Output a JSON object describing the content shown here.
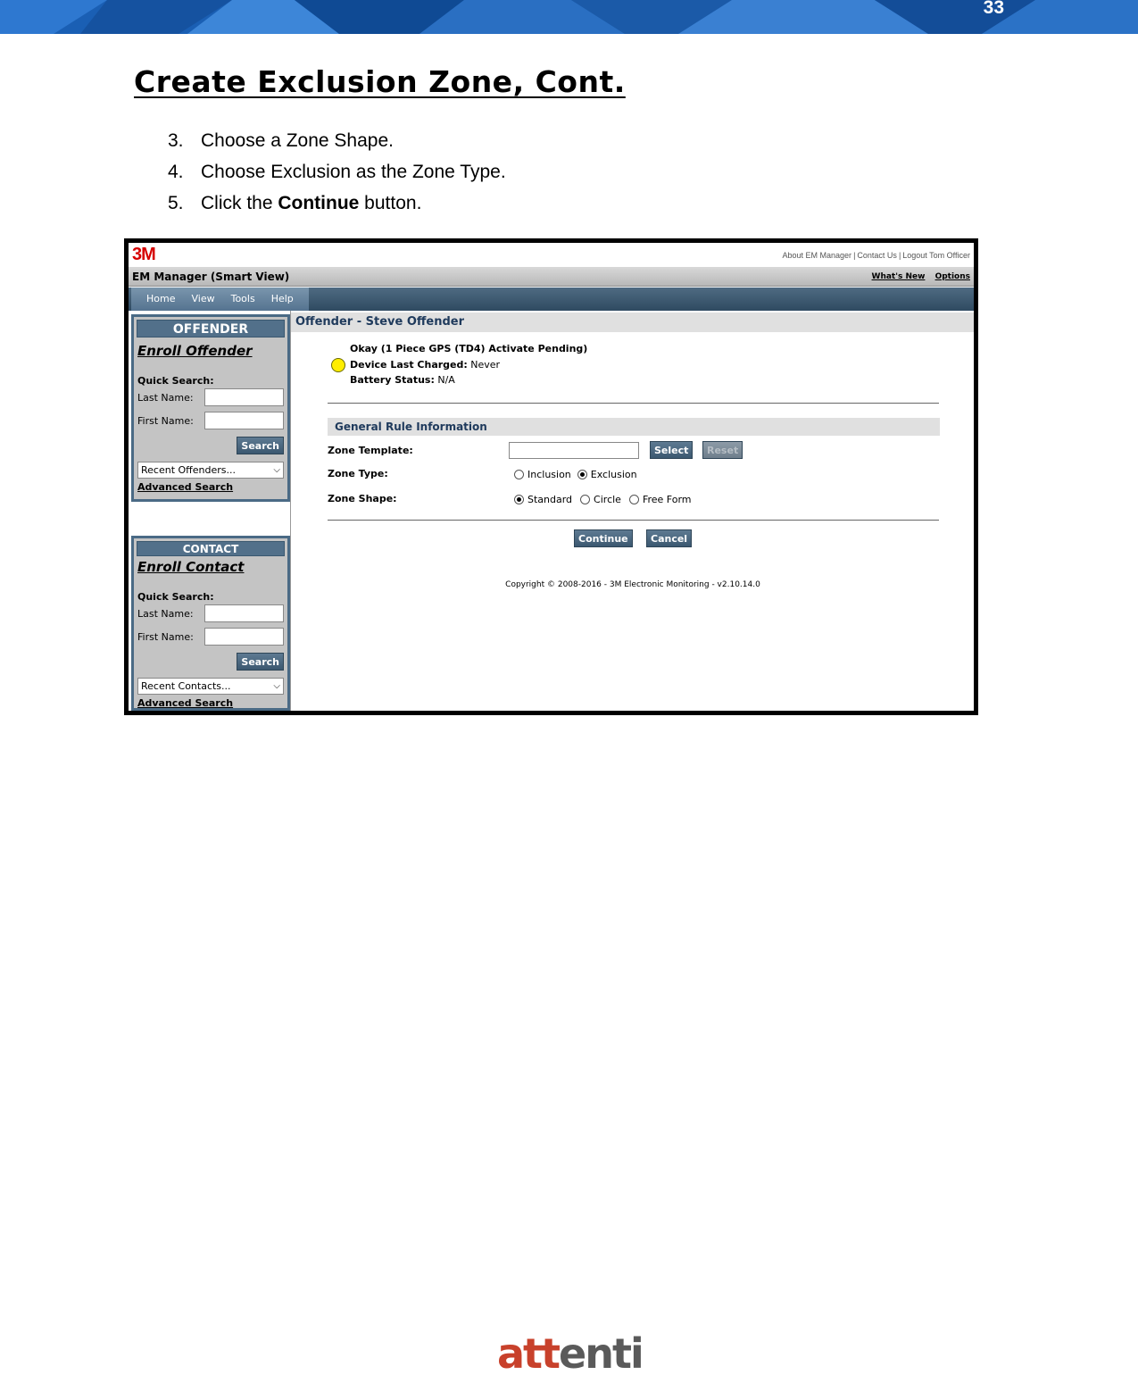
{
  "document": {
    "page_number": "33",
    "title": "Create Exclusion Zone, Cont.",
    "steps": [
      {
        "num": "3.",
        "text_before": "Choose a Zone Shape.",
        "bold": "",
        "text_after": ""
      },
      {
        "num": "4.",
        "text_before": "Choose Exclusion as the Zone Type.",
        "bold": "",
        "text_after": ""
      },
      {
        "num": "5.",
        "text_before": "Click the ",
        "bold": "Continue",
        "text_after": " button."
      }
    ],
    "brand": {
      "part_a": "att",
      "part_b": "enti"
    }
  },
  "app": {
    "logo": "3M",
    "top_links": [
      "About EM Manager",
      "Contact Us",
      "Logout Tom Officer"
    ],
    "title": "EM Manager (Smart View)",
    "title_links": [
      "What's New",
      "Options"
    ],
    "nav": [
      "Home",
      "View",
      "Tools",
      "Help"
    ],
    "offender_panel": {
      "header": "OFFENDER",
      "enroll_link": "Enroll Offender",
      "quick_search": "Quick Search:",
      "last_name_label": "Last Name:",
      "first_name_label": "First Name:",
      "search_button": "Search",
      "recent_select": "Recent Offenders...",
      "advanced_search": "Advanced Search"
    },
    "contact_panel": {
      "header": "CONTACT",
      "enroll_link": "Enroll Contact",
      "quick_search": "Quick Search:",
      "last_name_label": "Last Name:",
      "first_name_label": "First Name:",
      "search_button": "Search",
      "recent_select": "Recent Contacts...",
      "advanced_search": "Advanced Search"
    },
    "main": {
      "offender_header": "Offender - Steve Offender",
      "status": {
        "line1": "Okay (1 Piece GPS (TD4) Activate Pending)",
        "charged_label": "Device Last Charged:",
        "charged_value": " Never",
        "battery_label": "Battery Status:",
        "battery_value": " N/A",
        "indicator_color": "#ffee00"
      },
      "section_title": "General Rule Information",
      "zone_template_label": "Zone Template:",
      "zone_template_value": "",
      "select_button": "Select",
      "reset_button": "Reset",
      "zone_type_label": "Zone Type:",
      "zone_type_options": [
        "Inclusion",
        "Exclusion"
      ],
      "zone_type_selected": "Exclusion",
      "zone_shape_label": "Zone Shape:",
      "zone_shape_options": [
        "Standard",
        "Circle",
        "Free Form"
      ],
      "zone_shape_selected": "Standard",
      "continue_button": "Continue",
      "cancel_button": "Cancel",
      "copyright": "Copyright © 2008-2016 - 3M Electronic Monitoring - v2.10.14.0"
    }
  },
  "colors": {
    "banner_blue": "#1a5fb4",
    "nav_dark": "#2f4a61",
    "panel_head": "#52708a",
    "header_text": "#1f3a5c",
    "brand_red": "#c8412b",
    "brand_gray": "#5a5a5a"
  }
}
